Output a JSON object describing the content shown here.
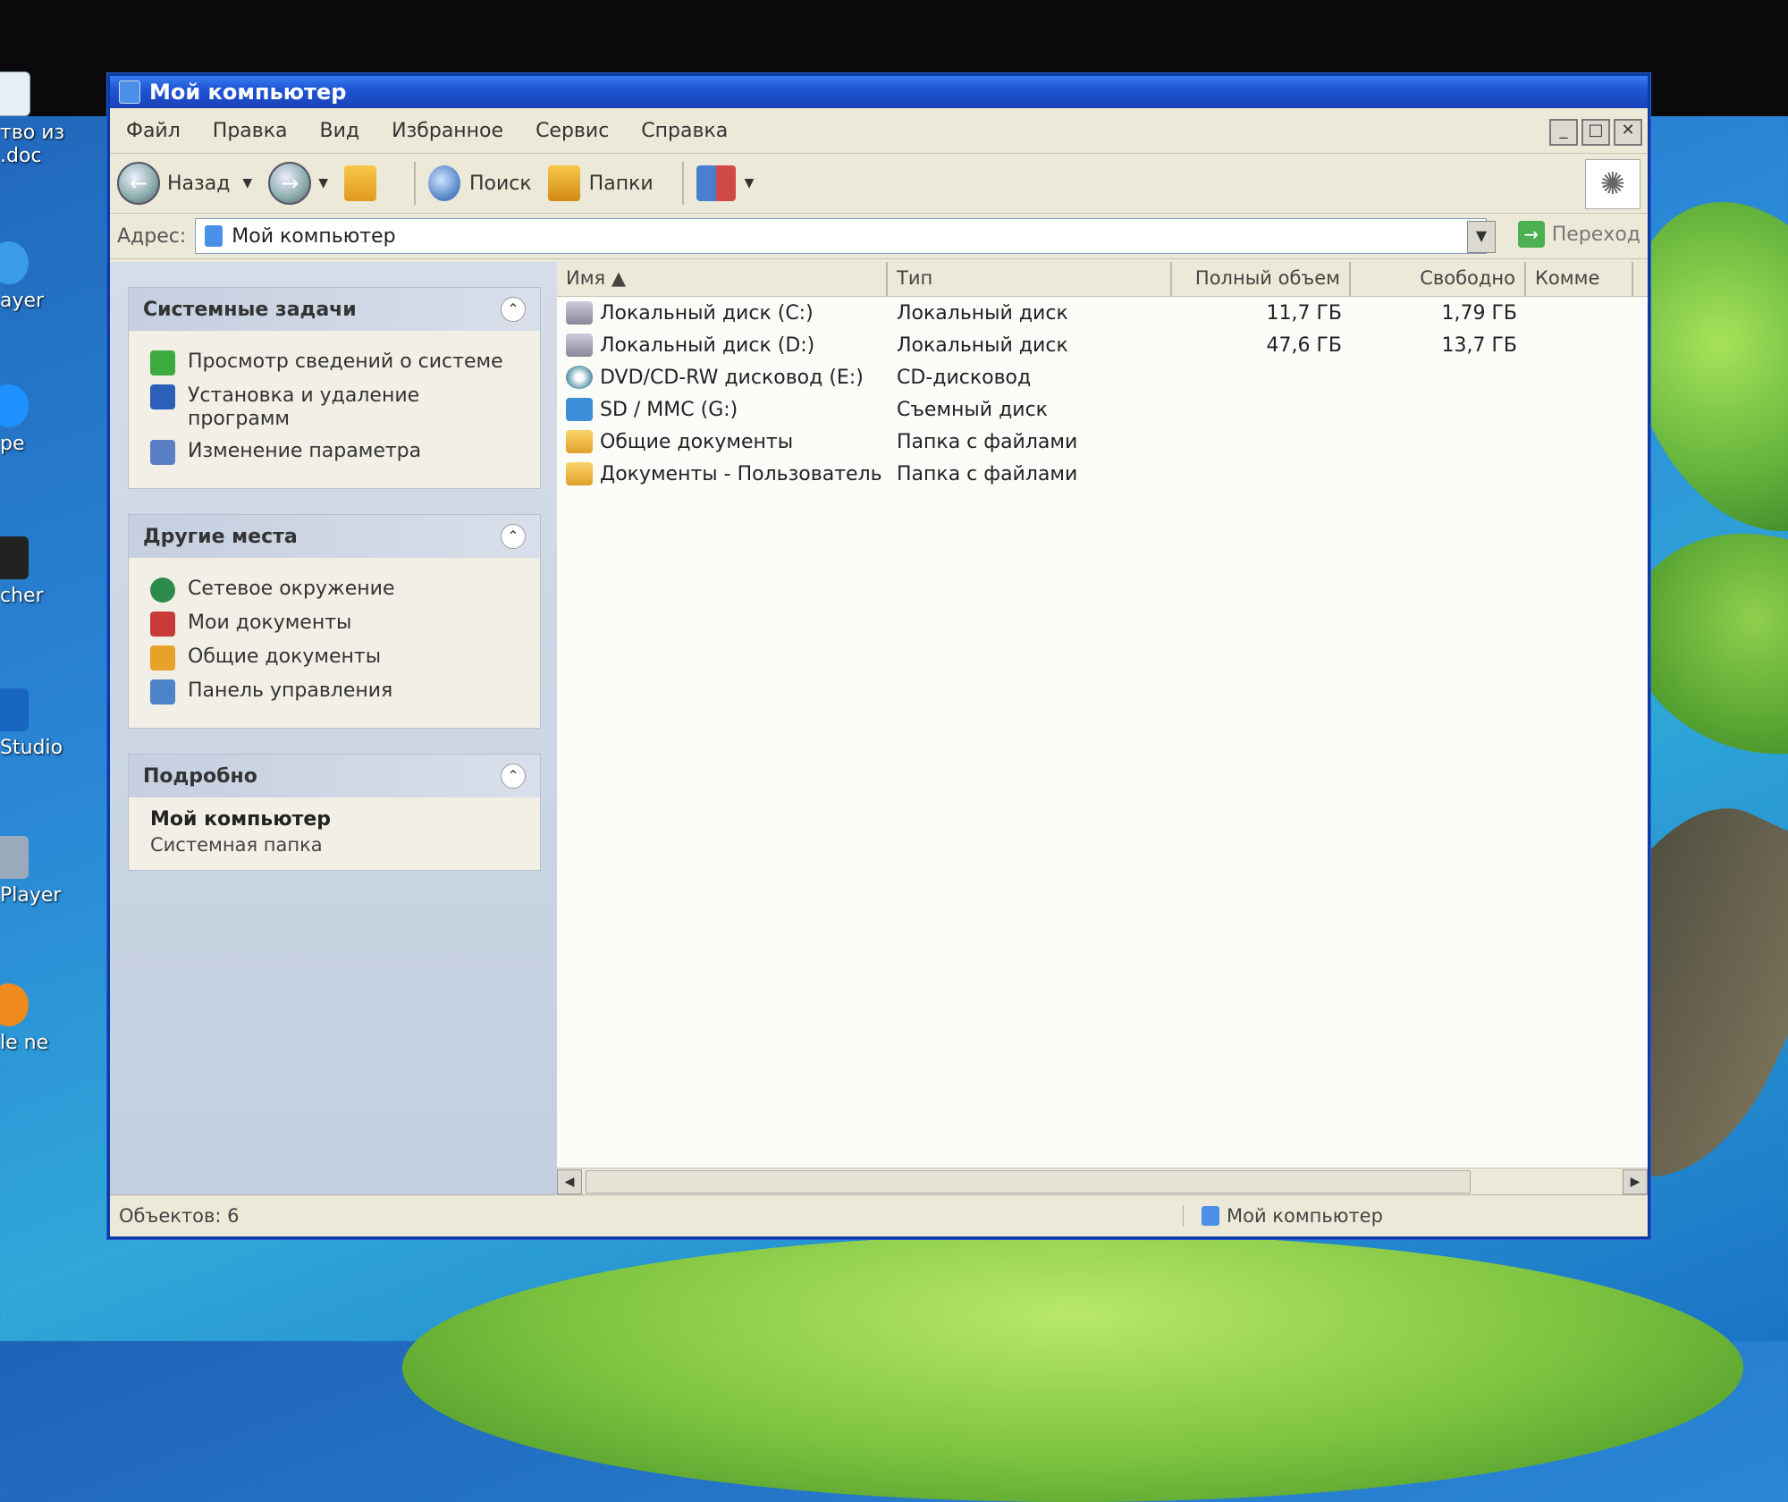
{
  "colors": {
    "titlebar": "#1f56d6",
    "window_bg": "#ece9d8",
    "taskpane_bg": "#c3cfe0",
    "desktop": "#2a86d6"
  },
  "desktop": {
    "icons": [
      {
        "label": "тво из .doc",
        "icon": "doc-icon"
      },
      {
        "label": "ayer",
        "icon": "player-icon"
      },
      {
        "label": "pe",
        "icon": "skype-icon"
      },
      {
        "label": "cher",
        "icon": "launcher-icon"
      },
      {
        "label": "Studio",
        "icon": "studio-icon"
      },
      {
        "label": "Player",
        "icon": "player-icon"
      },
      {
        "label": "le ne",
        "icon": "browser-icon"
      }
    ]
  },
  "window": {
    "title": "Мой компьютер",
    "menu": [
      "Файл",
      "Правка",
      "Вид",
      "Избранное",
      "Сервис",
      "Справка"
    ],
    "controls": {
      "minimize": "_",
      "maximize": "□",
      "close": "✕"
    },
    "toolbar": {
      "back": "Назад",
      "search": "Поиск",
      "folders": "Папки"
    },
    "address": {
      "label": "Адрес:",
      "value": "Мой компьютер",
      "go": "Переход"
    }
  },
  "taskpane": {
    "system_tasks": {
      "title": "Системные задачи",
      "items": [
        "Просмотр сведений о системе",
        "Установка и удаление программ",
        "Изменение параметра"
      ]
    },
    "other_places": {
      "title": "Другие места",
      "items": [
        "Сетевое окружение",
        "Мои документы",
        "Общие документы",
        "Панель управления"
      ]
    },
    "details": {
      "title": "Подробно",
      "name": "Мой компьютер",
      "type": "Системная папка"
    }
  },
  "filelist": {
    "headers": {
      "name": "Имя",
      "type": "Тип",
      "size": "Полный объем",
      "free": "Свободно",
      "comment": "Комме"
    },
    "rows": [
      {
        "name": "Локальный диск (C:)",
        "type": "Локальный диск",
        "size": "11,7 ГБ",
        "free": "1,79 ГБ",
        "icon": "hard-drive-icon"
      },
      {
        "name": "Локальный диск (D:)",
        "type": "Локальный диск",
        "size": "47,6 ГБ",
        "free": "13,7 ГБ",
        "icon": "hard-drive-icon"
      },
      {
        "name": "DVD/CD-RW дисковод (E:)",
        "type": "CD-дисковод",
        "size": "",
        "free": "",
        "icon": "cd-drive-icon"
      },
      {
        "name": "SD / MMC (G:)",
        "type": "Съемный диск",
        "size": "",
        "free": "",
        "icon": "removable-drive-icon"
      },
      {
        "name": "Общие документы",
        "type": "Папка с файлами",
        "size": "",
        "free": "",
        "icon": "folder-icon"
      },
      {
        "name": "Документы - Пользователь",
        "type": "Папка с файлами",
        "size": "",
        "free": "",
        "icon": "folder-icon"
      }
    ]
  },
  "statusbar": {
    "count": "Объектов: 6",
    "location": "Мой компьютер"
  }
}
